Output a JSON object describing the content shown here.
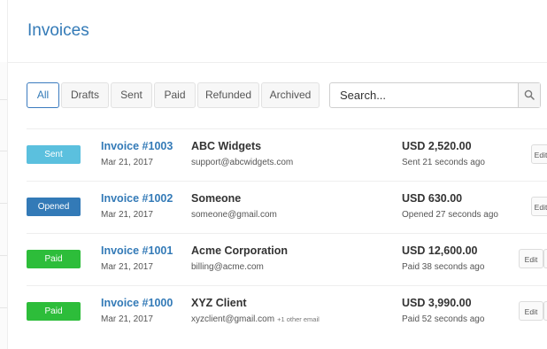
{
  "page": {
    "title": "Invoices"
  },
  "filters": [
    {
      "label": "All",
      "active": true
    },
    {
      "label": "Drafts"
    },
    {
      "label": "Sent"
    },
    {
      "label": "Paid"
    },
    {
      "label": "Refunded"
    },
    {
      "label": "Archived"
    }
  ],
  "search": {
    "placeholder": "Search...",
    "icon": "search-icon"
  },
  "colors": {
    "accent": "#337ab7",
    "sent": "#5bc0de",
    "opened": "#337ab7",
    "paid": "#2dbd3a"
  },
  "invoices": [
    {
      "status_badge": "Sent",
      "number": "Invoice #1003",
      "date": "Mar 21, 2017",
      "client": "ABC Widgets",
      "email": "support@abcwidgets.com",
      "extra_email": "",
      "amount": "USD 2,520.00",
      "status_text": "Sent 21 seconds ago",
      "edit_label": "Edit"
    },
    {
      "status_badge": "Opened",
      "number": "Invoice #1002",
      "date": "Mar 21, 2017",
      "client": "Someone",
      "email": "someone@gmail.com",
      "extra_email": "",
      "amount": "USD 630.00",
      "status_text": "Opened 27 seconds ago",
      "edit_label": "Edit"
    },
    {
      "status_badge": "Paid",
      "number": "Invoice #1001",
      "date": "Mar 21, 2017",
      "client": "Acme Corporation",
      "email": "billing@acme.com",
      "extra_email": "",
      "amount": "USD 12,600.00",
      "status_text": "Paid 38 seconds ago",
      "edit_label": "Edit"
    },
    {
      "status_badge": "Paid",
      "number": "Invoice #1000",
      "date": "Mar 21, 2017",
      "client": "XYZ Client",
      "email": "xyzclient@gmail.com",
      "extra_email": "+1 other email",
      "amount": "USD 3,990.00",
      "status_text": "Paid 52 seconds ago",
      "edit_label": "Edit"
    }
  ]
}
